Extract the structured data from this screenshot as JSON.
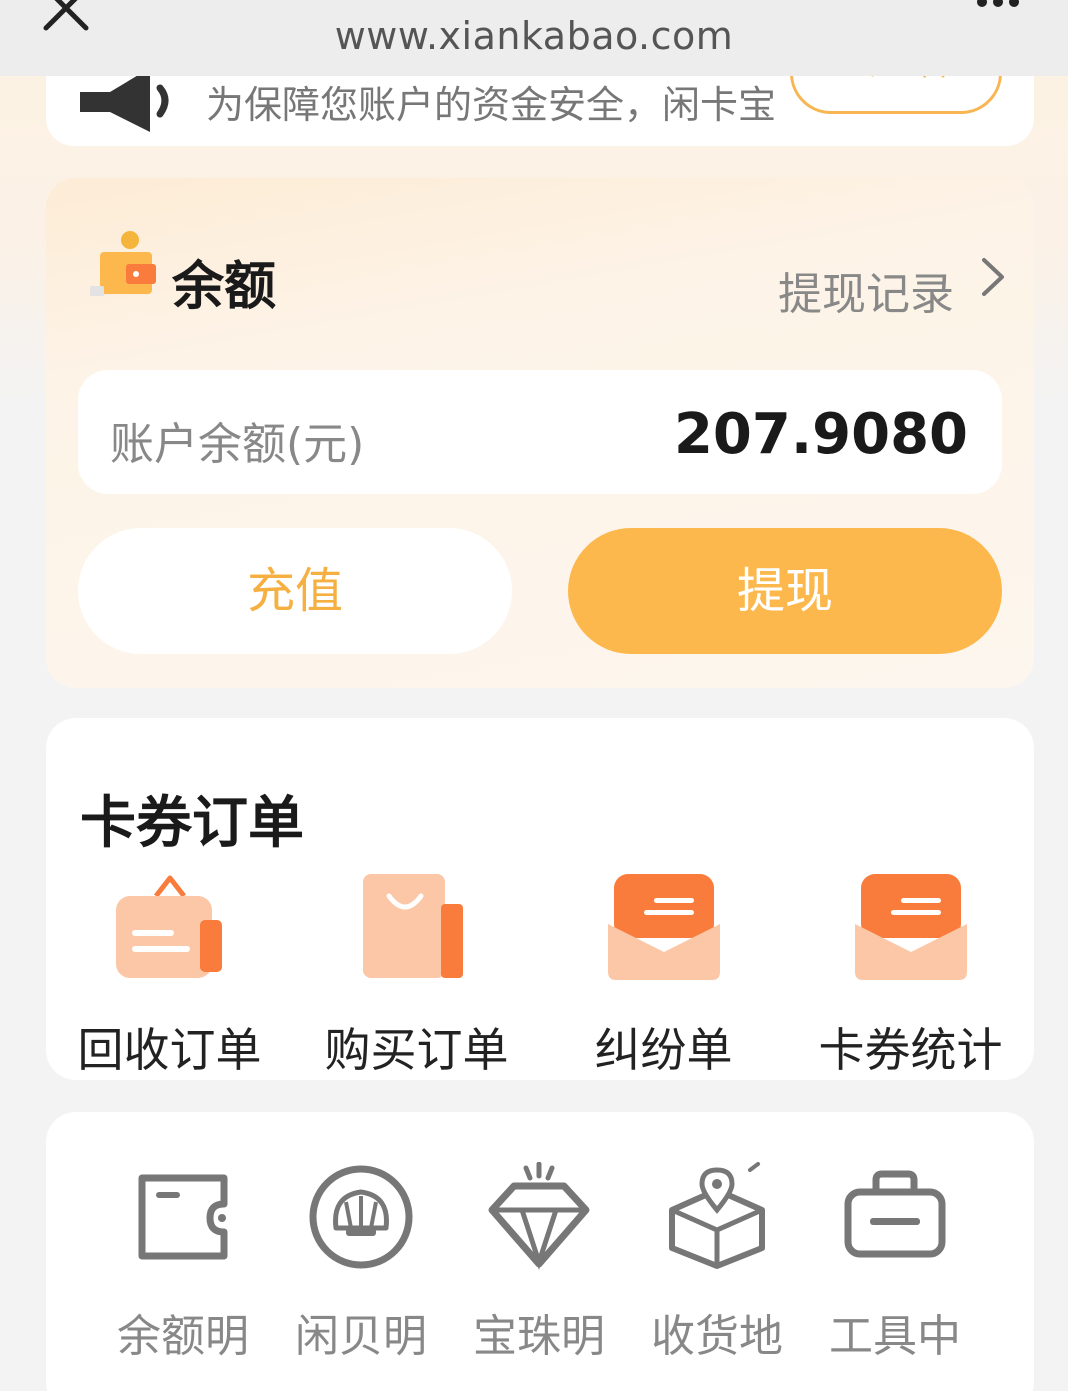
{
  "browser": {
    "url": "www.xiankabao.com"
  },
  "notice": {
    "text": "为保障您账户的资金安全，闲卡宝",
    "button_label": "去查看"
  },
  "balance": {
    "title": "余额",
    "withdraw_record_label": "提现记录",
    "account_label": "账户余额(元)",
    "account_value": "207.9080",
    "recharge_label": "充值",
    "withdraw_label": "提现"
  },
  "orders": {
    "title": "卡券订单",
    "items": [
      {
        "label": "回收订单",
        "icon": "recycle-order-icon"
      },
      {
        "label": "购买订单",
        "icon": "shopping-bag-icon"
      },
      {
        "label": "纠纷单",
        "icon": "envelope-icon"
      },
      {
        "label": "卡券统计",
        "icon": "envelope-icon"
      }
    ]
  },
  "tools": {
    "items": [
      {
        "label": "余额明",
        "icon": "wallet-icon"
      },
      {
        "label": "闲贝明",
        "icon": "shell-icon"
      },
      {
        "label": "宝珠明",
        "icon": "diamond-icon"
      },
      {
        "label": "收货地",
        "icon": "location-box-icon"
      },
      {
        "label": "工具中",
        "icon": "toolbox-icon"
      }
    ]
  },
  "colors": {
    "accent": "#fdb84d",
    "accent_text": "#f6b042",
    "order_icon": "#f97c3c"
  }
}
